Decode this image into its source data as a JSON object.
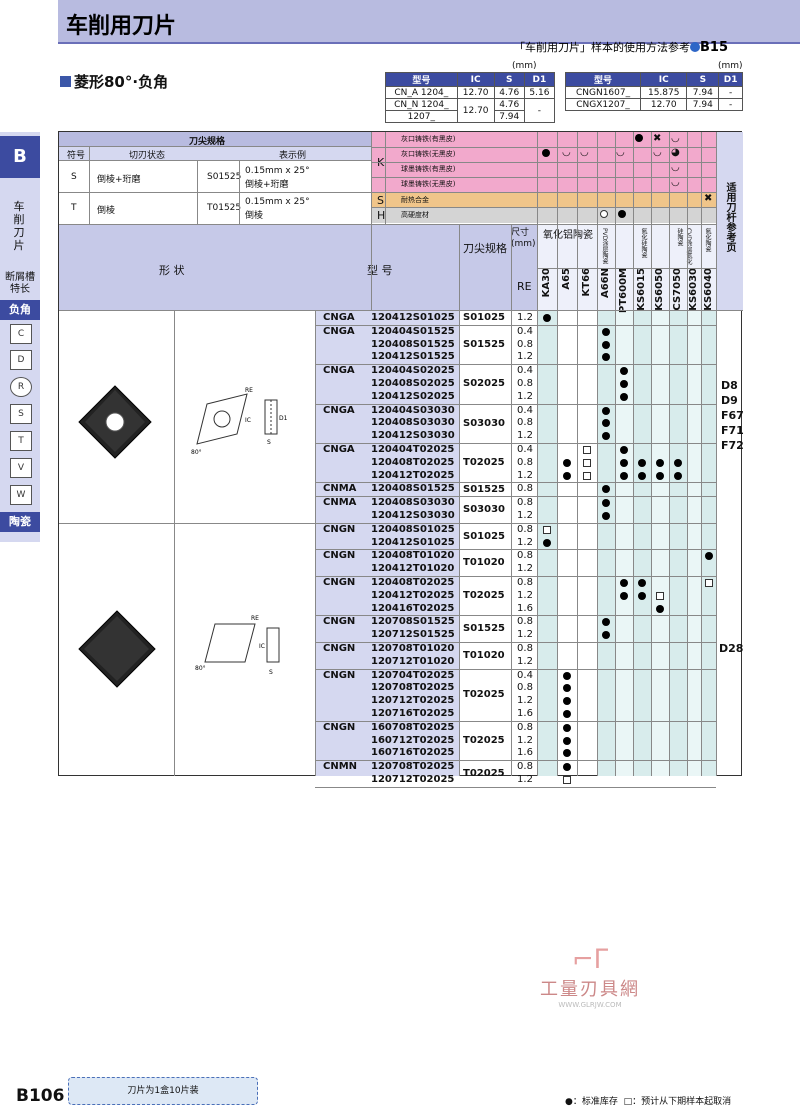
{
  "header": {
    "title": "车削用刀片",
    "ref_text": "「车削用刀片」样本的使用方法参考",
    "ref_page": "B15"
  },
  "subtitle": "菱形80°·负角",
  "spec_tables": {
    "unit": "(mm)",
    "columns": [
      "型号",
      "IC",
      "S",
      "D1"
    ],
    "left_rows": [
      [
        "CN_A 1204_",
        "12.70",
        "4.76",
        "5.16"
      ],
      [
        "CN_N 1204_",
        "12.70",
        "4.76",
        ""
      ],
      [
        "1207_",
        "",
        "7.94",
        "-"
      ]
    ],
    "right_rows": [
      [
        "CNGN1607_",
        "15.875",
        "7.94",
        "-"
      ],
      [
        "CNGX1207_",
        "12.70",
        "7.94",
        "-"
      ]
    ]
  },
  "side_nav": {
    "letter": "B",
    "section": "车削刀片",
    "groove": "断屑槽特长",
    "tab1": "负角",
    "shapes": [
      "C",
      "D",
      "R",
      "S",
      "T",
      "V",
      "W"
    ],
    "tab2": "陶瓷"
  },
  "edge_spec": {
    "title": "刀尖规格",
    "symbol": "符号",
    "state": "切刃状态",
    "example": "表示例",
    "rows": [
      {
        "sym": "S",
        "state": "倒棱+珩磨",
        "code": "S01525",
        "desc": "0.15mm x 25°",
        "desc2": "倒棱+珩磨"
      },
      {
        "sym": "T",
        "state": "倒棱",
        "code": "T01525",
        "desc": "0.15mm x 25°",
        "desc2": "倒棱"
      }
    ]
  },
  "materials": {
    "K": "K",
    "S": "S",
    "H": "H",
    "rows": [
      "灰口铸铁(有黑皮)",
      "灰口铸铁(无黑皮)",
      "球墨铸铁(有黑皮)",
      "球墨铸铁(无黑皮)",
      "耐热合金",
      "高硬度材"
    ]
  },
  "ref_col": "适用刀杆参考页",
  "labels": {
    "shape": "形 状",
    "model": "型 号",
    "edge": "刀尖规格",
    "size": "尺寸(mm)",
    "re": "RE",
    "alumina": "氧化铝陶瓷",
    "pvd": "PVD涂层陶瓷",
    "sialon": "氮化硅陶瓷",
    "cvd": "CVD涂层氮化硅陶瓷",
    "sin": "氮化陶瓷"
  },
  "grades": [
    "KA30",
    "A65",
    "KT66",
    "A66N",
    "PT600M",
    "KS6015",
    "KS6050",
    "CS7050",
    "KS6030",
    "KS6040"
  ],
  "groups": [
    {
      "family": [
        "CNGA"
      ],
      "codes": [
        "120412S01025"
      ],
      "edge": "S01025",
      "re": [
        "1.2"
      ],
      "marks": [
        [
          0,
          "d"
        ]
      ]
    },
    {
      "family": [
        "CNGA"
      ],
      "codes": [
        "120404S01525",
        "120408S01525",
        "120412S01525"
      ],
      "edge": "S01525",
      "re": [
        "0.4",
        "0.8",
        "1.2"
      ],
      "marks": [
        [
          3,
          "d"
        ],
        [
          3,
          "d"
        ],
        [
          3,
          "d"
        ]
      ]
    },
    {
      "family": [
        "CNGA"
      ],
      "codes": [
        "120404S02025",
        "120408S02025",
        "120412S02025"
      ],
      "edge": "S02025",
      "re": [
        "0.4",
        "0.8",
        "1.2"
      ],
      "marks": [
        [
          4,
          "d"
        ],
        [
          4,
          "d"
        ],
        [
          4,
          "d"
        ]
      ]
    },
    {
      "family": [
        "CNGA"
      ],
      "codes": [
        "120404S03030",
        "120408S03030",
        "120412S03030"
      ],
      "edge": "S03030",
      "re": [
        "0.4",
        "0.8",
        "1.2"
      ],
      "marks": [
        [
          3,
          "d"
        ],
        [
          3,
          "d"
        ],
        [
          3,
          "d"
        ]
      ]
    },
    {
      "family": [
        "CNGA"
      ],
      "codes": [
        "120404T02025",
        "120408T02025",
        "120412T02025"
      ],
      "edge": "T02025",
      "re": [
        "0.4",
        "0.8",
        "1.2"
      ],
      "marks": [
        [
          2,
          "b",
          4,
          "d"
        ],
        [
          1,
          "d",
          2,
          "b",
          4,
          "d",
          5,
          "d",
          6,
          "d",
          7,
          "d"
        ],
        [
          1,
          "d",
          2,
          "b",
          4,
          "d",
          5,
          "d",
          6,
          "d",
          7,
          "d"
        ]
      ]
    },
    {
      "family": [
        "CNMA"
      ],
      "codes": [
        "120408S01525"
      ],
      "edge": "S01525",
      "re": [
        "0.8"
      ],
      "marks": [
        [
          3,
          "d"
        ]
      ]
    },
    {
      "family": [
        "CNMA"
      ],
      "codes": [
        "120408S03030",
        "120412S03030"
      ],
      "edge": "S03030",
      "re": [
        "0.8",
        "1.2"
      ],
      "marks": [
        [
          3,
          "d"
        ],
        [
          3,
          "d"
        ]
      ]
    },
    {
      "family": [
        "CNGN"
      ],
      "codes": [
        "120408S01025",
        "120412S01025"
      ],
      "edge": "S01025",
      "re": [
        "0.8",
        "1.2"
      ],
      "marks": [
        [
          0,
          "b"
        ],
        [
          0,
          "d"
        ]
      ]
    },
    {
      "family": [
        "CNGN"
      ],
      "codes": [
        "120408T01020",
        "120412T01020"
      ],
      "edge": "T01020",
      "re": [
        "0.8",
        "1.2"
      ],
      "marks": [
        [
          9,
          "d"
        ],
        []
      ]
    },
    {
      "family": [
        "CNGN"
      ],
      "codes": [
        "120408T02025",
        "120412T02025",
        "120416T02025"
      ],
      "edge": "T02025",
      "re": [
        "0.8",
        "1.2",
        "1.6"
      ],
      "marks": [
        [
          4,
          "d",
          5,
          "d",
          9,
          "b"
        ],
        [
          4,
          "d",
          5,
          "d",
          6,
          "b"
        ],
        [
          6,
          "d"
        ]
      ]
    },
    {
      "family": [
        "CNGN"
      ],
      "codes": [
        "120708S01525",
        "120712S01525"
      ],
      "edge": "S01525",
      "re": [
        "0.8",
        "1.2"
      ],
      "marks": [
        [
          3,
          "d"
        ],
        [
          3,
          "d"
        ]
      ]
    },
    {
      "family": [
        "CNGN"
      ],
      "codes": [
        "120708T01020",
        "120712T01020"
      ],
      "edge": "T01020",
      "re": [
        "0.8",
        "1.2"
      ],
      "marks": [
        [],
        []
      ]
    },
    {
      "family": [
        "CNGN"
      ],
      "codes": [
        "120704T02025",
        "120708T02025",
        "120712T02025",
        "120716T02025"
      ],
      "edge": "T02025",
      "re": [
        "0.4",
        "0.8",
        "1.2",
        "1.6"
      ],
      "marks": [
        [
          1,
          "d"
        ],
        [
          1,
          "d"
        ],
        [
          1,
          "d"
        ],
        [
          1,
          "d"
        ]
      ]
    },
    {
      "family": [
        "CNGN"
      ],
      "codes": [
        "160708T02025",
        "160712T02025",
        "160716T02025"
      ],
      "edge": "T02025",
      "re": [
        "0.8",
        "1.2",
        "1.6"
      ],
      "marks": [
        [
          1,
          "d"
        ],
        [
          1,
          "d"
        ],
        [
          1,
          "d"
        ]
      ]
    },
    {
      "family": [
        "CNMN"
      ],
      "codes": [
        "120708T02025",
        "120712T02025"
      ],
      "edge": "T02025",
      "re": [
        "0.8",
        "1.2"
      ],
      "marks": [
        [
          1,
          "d"
        ],
        [
          1,
          "b"
        ]
      ]
    }
  ],
  "ref_pages_top": [
    "D8",
    "D9",
    "F67",
    "F71",
    "F72"
  ],
  "ref_pages_bottom": [
    "D28"
  ],
  "watermark": "工量刃具網",
  "watermark_url": "WWW.GLRJW.COM",
  "footer": {
    "box": "刀片为1盒10片装",
    "page": "B106",
    "legend_dot": "●：标准库存",
    "legend_box": "□：预计从下期样本起取消"
  }
}
